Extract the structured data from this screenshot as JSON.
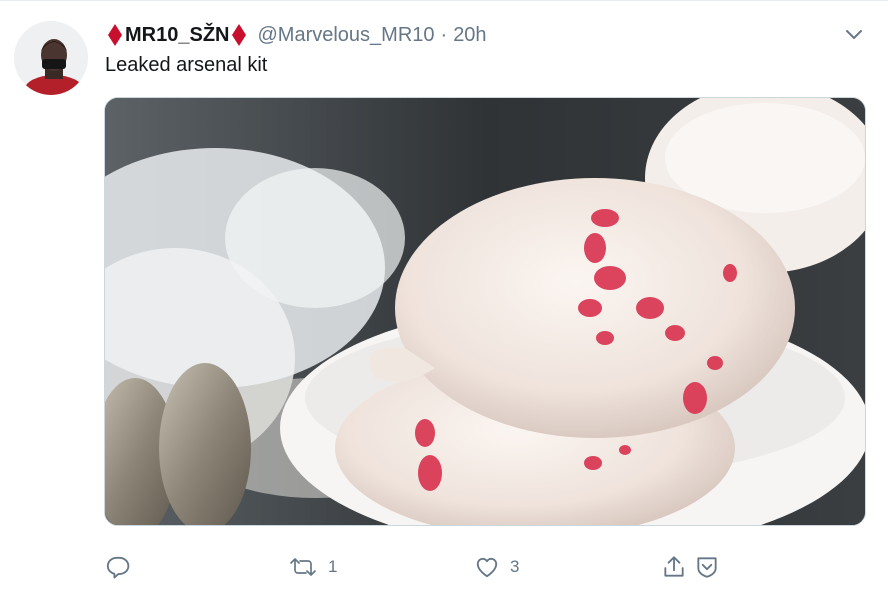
{
  "tweet": {
    "display_name": "MR10_SŽN",
    "handle": "@Marvelous_MR10",
    "separator": "·",
    "timestamp": "20h",
    "text": "Leaked arsenal kit",
    "name_emoji": "red-diamond-icon"
  },
  "actions": {
    "reply": {
      "icon": "reply-icon",
      "count": ""
    },
    "retweet": {
      "icon": "retweet-icon",
      "count": "1"
    },
    "like": {
      "icon": "heart-icon",
      "count": "3"
    },
    "share": {
      "icon": "share-icon"
    },
    "bookmark": {
      "icon": "shield-chevron-icon"
    }
  },
  "colors": {
    "text": "#14171a",
    "secondary": "#657786",
    "border": "#ccd6dd",
    "emoji_red": "#c8102e"
  }
}
